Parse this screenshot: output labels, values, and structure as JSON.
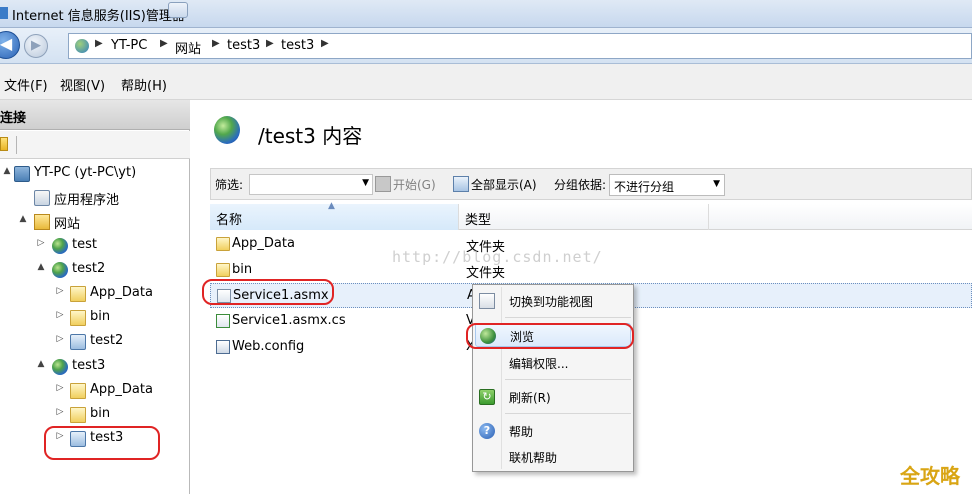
{
  "window": {
    "title": "Internet 信息服务(IIS)管理器"
  },
  "address": {
    "crumbs": [
      "YT-PC",
      "网站",
      "test3",
      "test3"
    ]
  },
  "menu": {
    "items": [
      "文件(F)",
      "视图(V)",
      "帮助(H)"
    ]
  },
  "connections": {
    "header": "连接",
    "tree": [
      {
        "label": "YT-PC (yt-PC\\yt)",
        "icon": "server-icon",
        "toggle": "▲"
      },
      {
        "label": "应用程序池",
        "icon": "app-pool-icon",
        "toggle": ""
      },
      {
        "label": "网站",
        "icon": "sites-folder-icon",
        "toggle": "▲"
      },
      {
        "label": "test",
        "icon": "globe-icon",
        "toggle": "▷"
      },
      {
        "label": "test2",
        "icon": "globe-icon",
        "toggle": "▲"
      },
      {
        "label": "App_Data",
        "icon": "folder-icon",
        "toggle": "▷"
      },
      {
        "label": "bin",
        "icon": "folder-icon",
        "toggle": "▷"
      },
      {
        "label": "test2",
        "icon": "application-icon",
        "toggle": "▷"
      },
      {
        "label": "test3",
        "icon": "globe-icon",
        "toggle": "▲"
      },
      {
        "label": "App_Data",
        "icon": "folder-icon",
        "toggle": "▷"
      },
      {
        "label": "bin",
        "icon": "folder-icon",
        "toggle": "▷"
      },
      {
        "label": "test3",
        "icon": "application-icon",
        "toggle": "▷"
      }
    ]
  },
  "content": {
    "title": "/test3 内容",
    "filter": {
      "label": "筛选:",
      "start": "开始(G)",
      "show_all": "全部显示(A)",
      "group_by_label": "分组依据:",
      "group_by_value": "不进行分组"
    },
    "columns": {
      "name": "名称",
      "type": "类型"
    },
    "rows": [
      {
        "name": "App_Data",
        "type": "文件夹",
        "icon": "folder-icon"
      },
      {
        "name": "bin",
        "type": "文件夹",
        "icon": "folder-icon"
      },
      {
        "name": "Service1.asmx",
        "type": "A",
        "icon": "asmx-file-icon"
      },
      {
        "name": "Service1.asmx.cs",
        "type": "V",
        "icon": "cs-file-icon"
      },
      {
        "name": "Web.config",
        "type": "X",
        "icon": "config-file-icon"
      }
    ],
    "watermark": "http://blog.csdn.net/"
  },
  "context_menu": {
    "items": [
      "切换到功能视图",
      "浏览",
      "编辑权限...",
      "刷新(R)",
      "帮助",
      "联机帮助"
    ]
  },
  "brand_mark": "全攻略"
}
